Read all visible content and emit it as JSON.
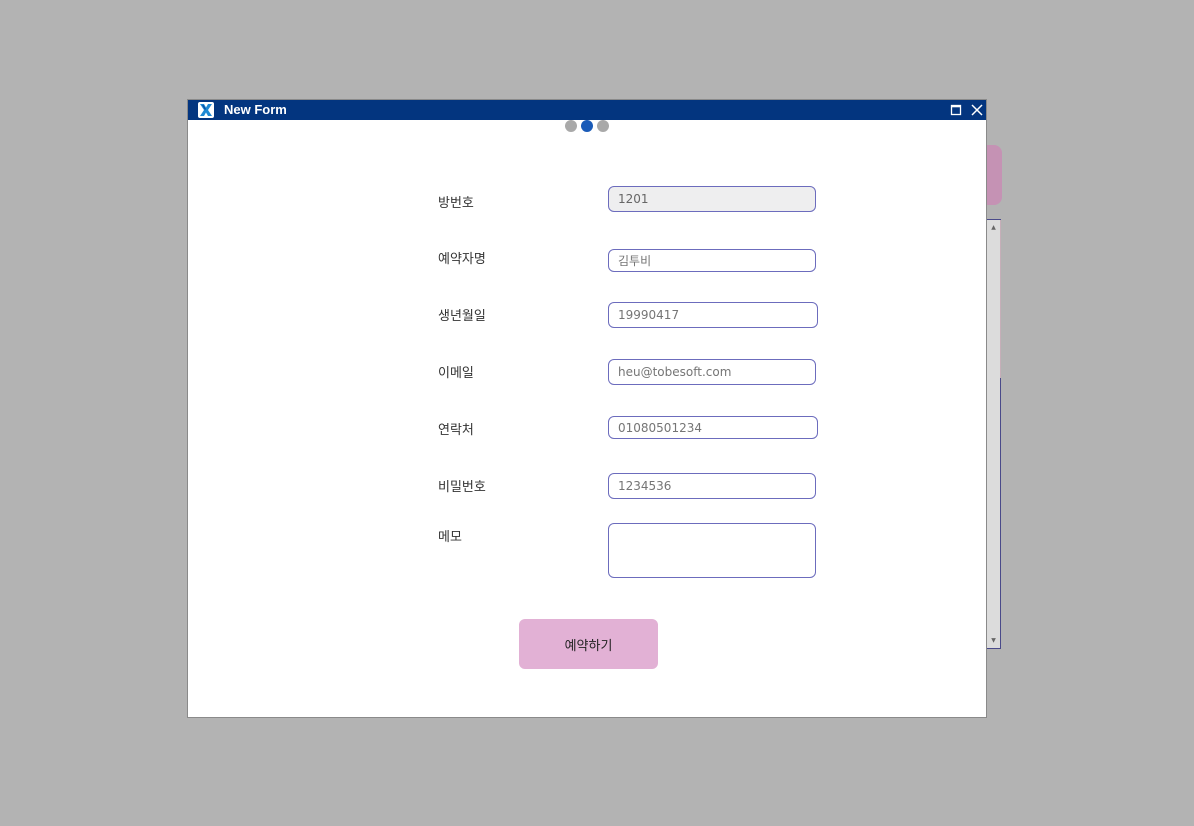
{
  "window": {
    "title": "New Form",
    "icon": "app-x-icon",
    "maximize_icon": "maximize-icon",
    "close_icon": "close-icon",
    "title_bar_color": "#03357f"
  },
  "steps": {
    "count": 3,
    "active_index": 1,
    "active_color": "#1a5bb8",
    "inactive_color": "#a9a9a9"
  },
  "form": {
    "fields": [
      {
        "label": "방번호",
        "value": "1201",
        "readonly": true
      },
      {
        "label": "예약자명",
        "placeholder": "김투비"
      },
      {
        "label": "생년월일",
        "placeholder": "19990417"
      },
      {
        "label": "이메일",
        "placeholder": "heu@tobesoft.com"
      },
      {
        "label": "연락처",
        "placeholder": "01080501234"
      },
      {
        "label": "비밀번호",
        "placeholder": "1234536"
      }
    ],
    "memo_label": "메모",
    "memo_value": "",
    "submit_label": "예약하기",
    "submit_color": "#e2b1d5",
    "field_border_color": "#6c6cbd"
  }
}
